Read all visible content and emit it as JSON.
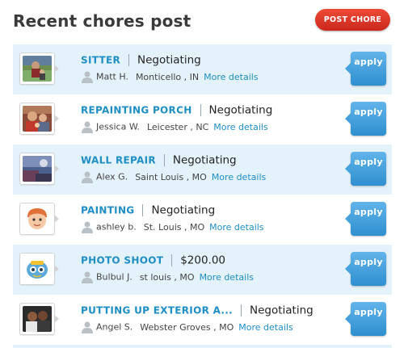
{
  "header": {
    "title": "Recent chores post",
    "post_button_label": "POST CHORE"
  },
  "chores": [
    {
      "title": "SITTER",
      "status": "Negotiating",
      "user": "Matt H.",
      "location": "Monticello , IN",
      "more": "More details",
      "apply": "apply",
      "thumb": "photo-outdoor-icon"
    },
    {
      "title": "REPAINTING PORCH",
      "status": "Negotiating",
      "user": "Jessica W.",
      "location": "Leicester , NC",
      "more": "More details",
      "apply": "apply",
      "thumb": "photo-family-icon"
    },
    {
      "title": "WALL REPAIR",
      "status": "Negotiating",
      "user": "Alex G.",
      "location": "Saint Louis , MO",
      "more": "More details",
      "apply": "apply",
      "thumb": "photo-sky-icon"
    },
    {
      "title": "PAINTING",
      "status": "Negotiating",
      "user": "ashley b.",
      "location": "St. Louis , MO",
      "more": "More details",
      "apply": "apply",
      "thumb": "cartoon-face-icon"
    },
    {
      "title": "PHOTO SHOOT",
      "status": "$200.00",
      "user": "Bulbul J.",
      "location": "st louis , MO",
      "more": "More details",
      "apply": "apply",
      "thumb": "cartoon-avatar-icon"
    },
    {
      "title": "PUTTING UP EXTERIOR A...",
      "status": "Negotiating",
      "user": "Angel S.",
      "location": "Webster Groves , MO",
      "more": "More details",
      "apply": "apply",
      "thumb": "photo-couple-icon"
    }
  ],
  "colors": {
    "accent_blue": "#1e8ec4",
    "row_shade": "#e4f2fb",
    "post_button": "#d9342a",
    "apply_button": "#3d9ad6"
  }
}
